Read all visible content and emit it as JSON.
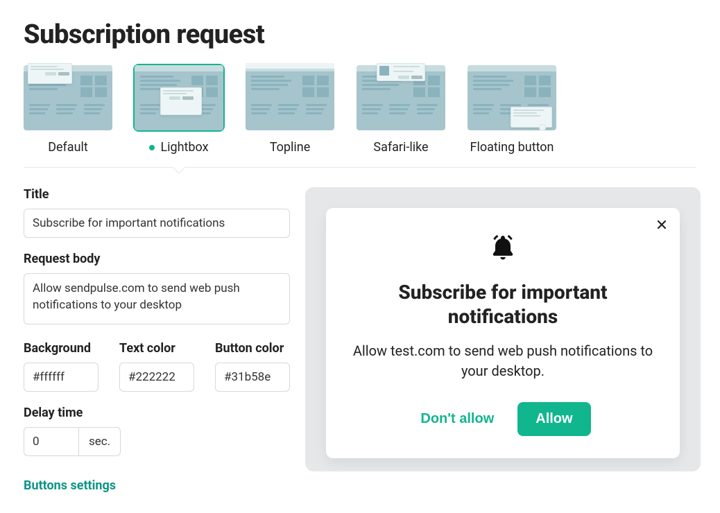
{
  "page": {
    "title": "Subscription request"
  },
  "options": [
    {
      "label": "Default"
    },
    {
      "label": "Lightbox"
    },
    {
      "label": "Topline"
    },
    {
      "label": "Safari-like"
    },
    {
      "label": "Floating button"
    }
  ],
  "selected_option_index": 1,
  "form": {
    "title_label": "Title",
    "title_value": "Subscribe for important notifications",
    "body_label": "Request body",
    "body_value": "Allow sendpulse.com to send web push notifications to your desktop",
    "background_label": "Background",
    "background_value": "#ffffff",
    "text_color_label": "Text color",
    "text_color_value": "#222222",
    "button_color_label": "Button color",
    "button_color_value": "#31b58e",
    "delay_label": "Delay time",
    "delay_value": "0",
    "delay_unit": "sec.",
    "buttons_settings_label": "Buttons settings"
  },
  "preview": {
    "title": "Subscribe for important notifications",
    "body": "Allow test.com to send web push notifications to your desktop.",
    "deny_label": "Don't allow",
    "allow_label": "Allow"
  },
  "icons": {
    "bell": "bell-icon",
    "close": "close-icon"
  },
  "colors": {
    "accent": "#11b58e",
    "panel": "#e5e7e9",
    "thumb_bg": "#a5c4cc"
  }
}
